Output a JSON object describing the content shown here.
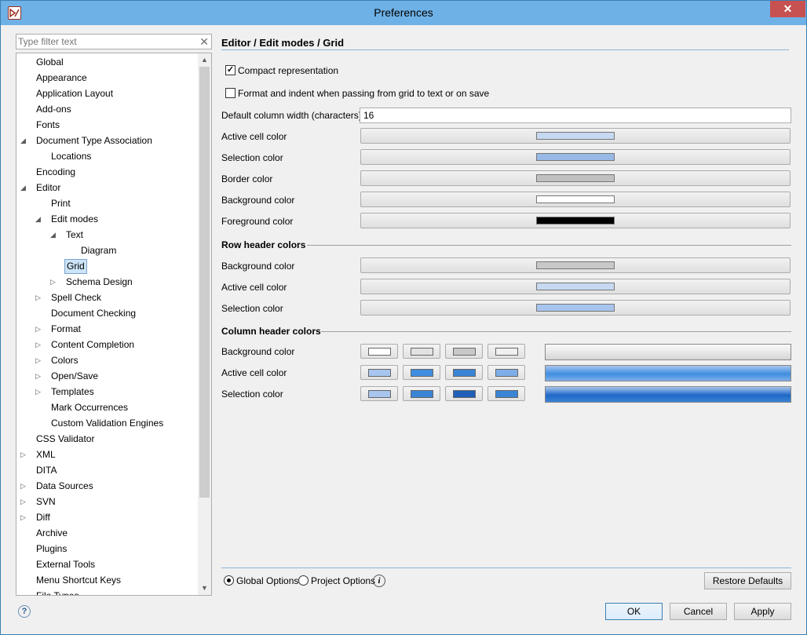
{
  "window": {
    "title": "Preferences",
    "close_glyph": "✕"
  },
  "filter": {
    "placeholder": "Type filter text",
    "clear_glyph": "✕"
  },
  "tree": {
    "items": [
      {
        "label": "Global",
        "level": 0,
        "arrow": ""
      },
      {
        "label": "Appearance",
        "level": 0,
        "arrow": ""
      },
      {
        "label": "Application Layout",
        "level": 0,
        "arrow": ""
      },
      {
        "label": "Add-ons",
        "level": 0,
        "arrow": ""
      },
      {
        "label": "Fonts",
        "level": 0,
        "arrow": ""
      },
      {
        "label": "Document Type Association",
        "level": 0,
        "arrow": "expanded"
      },
      {
        "label": "Locations",
        "level": 1,
        "arrow": ""
      },
      {
        "label": "Encoding",
        "level": 0,
        "arrow": ""
      },
      {
        "label": "Editor",
        "level": 0,
        "arrow": "expanded"
      },
      {
        "label": "Print",
        "level": 1,
        "arrow": ""
      },
      {
        "label": "Edit modes",
        "level": 1,
        "arrow": "expanded"
      },
      {
        "label": "Text",
        "level": 2,
        "arrow": "expanded"
      },
      {
        "label": "Diagram",
        "level": 3,
        "arrow": ""
      },
      {
        "label": "Grid",
        "level": 2,
        "arrow": "",
        "selected": true
      },
      {
        "label": "Schema Design",
        "level": 2,
        "arrow": "collapsed"
      },
      {
        "label": "Spell Check",
        "level": 1,
        "arrow": "collapsed"
      },
      {
        "label": "Document Checking",
        "level": 1,
        "arrow": ""
      },
      {
        "label": "Format",
        "level": 1,
        "arrow": "collapsed"
      },
      {
        "label": "Content Completion",
        "level": 1,
        "arrow": "collapsed"
      },
      {
        "label": "Colors",
        "level": 1,
        "arrow": "collapsed"
      },
      {
        "label": "Open/Save",
        "level": 1,
        "arrow": "collapsed"
      },
      {
        "label": "Templates",
        "level": 1,
        "arrow": "collapsed"
      },
      {
        "label": "Mark Occurrences",
        "level": 1,
        "arrow": ""
      },
      {
        "label": "Custom Validation Engines",
        "level": 1,
        "arrow": ""
      },
      {
        "label": "CSS Validator",
        "level": 0,
        "arrow": ""
      },
      {
        "label": "XML",
        "level": 0,
        "arrow": "collapsed"
      },
      {
        "label": "DITA",
        "level": 0,
        "arrow": ""
      },
      {
        "label": "Data Sources",
        "level": 0,
        "arrow": "collapsed"
      },
      {
        "label": "SVN",
        "level": 0,
        "arrow": "collapsed"
      },
      {
        "label": "Diff",
        "level": 0,
        "arrow": "collapsed"
      },
      {
        "label": "Archive",
        "level": 0,
        "arrow": ""
      },
      {
        "label": "Plugins",
        "level": 0,
        "arrow": ""
      },
      {
        "label": "External Tools",
        "level": 0,
        "arrow": ""
      },
      {
        "label": "Menu Shortcut Keys",
        "level": 0,
        "arrow": ""
      },
      {
        "label": "File Types",
        "level": 0,
        "arrow": ""
      }
    ]
  },
  "page": {
    "title": "Editor / Edit modes / Grid",
    "compact_label": "Compact representation",
    "compact_checked": true,
    "format_label": "Format and indent when passing from grid to text or on save",
    "format_checked": false,
    "col_width_label": "Default column width (characters)",
    "col_width_value": "16",
    "cell_colors": [
      {
        "label": "Active cell color",
        "color": "#c6d9f1"
      },
      {
        "label": "Selection color",
        "color": "#99b9e6"
      },
      {
        "label": "Border color",
        "color": "#c0c0c0"
      },
      {
        "label": "Background color",
        "color": "#ffffff"
      },
      {
        "label": "Foreground color",
        "color": "#000000"
      }
    ],
    "row_header_title": "Row header colors",
    "row_header_colors": [
      {
        "label": "Background color",
        "color": "#c8c8c8"
      },
      {
        "label": "Active cell color",
        "color": "#c6d9f1"
      },
      {
        "label": "Selection color",
        "color": "#a7c5ee"
      }
    ],
    "column_header_title": "Column header colors",
    "column_header_colors": [
      {
        "label": "Background color",
        "swatches": [
          "#ffffff",
          "#e2e2e2",
          "#c8c8c8",
          "#f0f0f0"
        ],
        "preview_top": "#fafafa",
        "preview_mid": "#e6e6e6",
        "preview_bottom": "#d4d4d4"
      },
      {
        "label": "Active cell color",
        "swatches": [
          "#a7c5ee",
          "#3f8ee0",
          "#3a84d6",
          "#7eaee9"
        ],
        "preview_top": "#a7c5ee",
        "preview_mid": "#3f8ee0",
        "preview_bottom": "#7eaee9"
      },
      {
        "label": "Selection color",
        "swatches": [
          "#a7c5ee",
          "#3a84d6",
          "#1f5fb8",
          "#3a84d6"
        ],
        "preview_top": "#a7c5ee",
        "preview_mid": "#1f68c7",
        "preview_bottom": "#3a84d6"
      }
    ]
  },
  "footer": {
    "global_options_label": "Global Options",
    "project_options_label": "Project Options",
    "global_selected": true,
    "info_glyph": "i",
    "restore_label": "Restore Defaults",
    "ok_label": "OK",
    "cancel_label": "Cancel",
    "apply_label": "Apply",
    "help_glyph": "?"
  },
  "colors": {
    "titlebar": "#6eb1e6",
    "close": "#c75050",
    "accent_rule": "#8cb4d8"
  }
}
